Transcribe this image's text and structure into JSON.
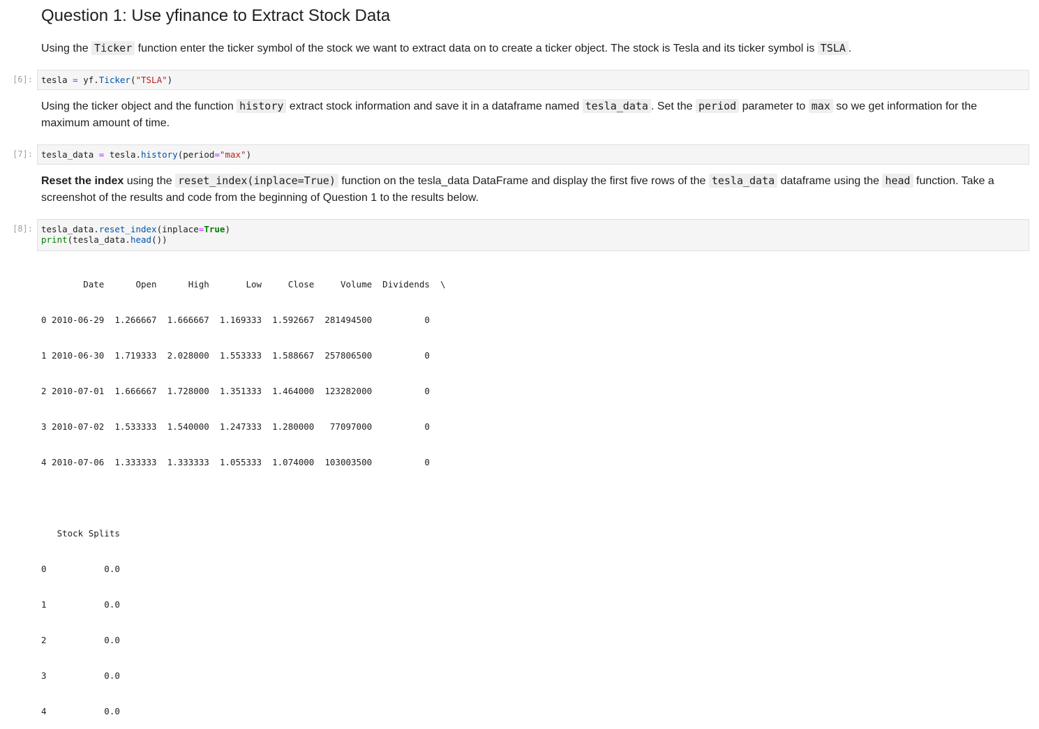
{
  "heading": "Question 1: Use yfinance to Extract Stock Data",
  "p1": {
    "t1": "Using the ",
    "c1": "Ticker",
    "t2": " function enter the ticker symbol of the stock we want to extract data on to create a ticker object. The stock is Tesla and its ticker symbol is ",
    "c2": "TSLA",
    "t3": "."
  },
  "cell6": {
    "prompt": "[6]:",
    "a": "tesla ",
    "op": "=",
    "b": " yf.",
    "fn": "Ticker",
    "c": "(",
    "str": "\"TSLA\"",
    "d": ")"
  },
  "p2": {
    "t1": "Using the ticker object and the function ",
    "c1": "history",
    "t2": " extract stock information and save it in a dataframe named ",
    "c2": "tesla_data",
    "t3": ". Set the ",
    "c3": "period",
    "t4": " parameter to ",
    "c4": "max",
    "t5": " so we get information for the maximum amount of time."
  },
  "cell7": {
    "prompt": "[7]:",
    "a": "tesla_data ",
    "op": "=",
    "b": " tesla.",
    "fn": "history",
    "c": "(period",
    "op2": "=",
    "str": "\"max\"",
    "d": ")"
  },
  "p3": {
    "bold": "Reset the index",
    "t1": " using the ",
    "c1": "reset_index(inplace=True)",
    "t2": " function on the tesla_data DataFrame and display the first five rows of the ",
    "c2": "tesla_data",
    "t3": " dataframe using the ",
    "c3": "head",
    "t4": " function. Take a screenshot of the results and code from the beginning of Question 1 to the results below."
  },
  "cell8": {
    "prompt": "[8]:",
    "l1a": "tesla_data.",
    "l1fn": "reset_index",
    "l1b": "(inplace",
    "l1op": "=",
    "l1kw": "True",
    "l1c": ")",
    "l2fn": "print",
    "l2a": "(tesla_data.",
    "l2fn2": "head",
    "l2b": "())"
  },
  "output": {
    "lines": [
      "        Date      Open      High       Low     Close     Volume  Dividends  \\",
      "0 2010-06-29  1.266667  1.666667  1.169333  1.592667  281494500          0",
      "1 2010-06-30  1.719333  2.028000  1.553333  1.588667  257806500          0",
      "2 2010-07-01  1.666667  1.728000  1.351333  1.464000  123282000          0",
      "3 2010-07-02  1.533333  1.540000  1.247333  1.280000   77097000          0",
      "4 2010-07-06  1.333333  1.333333  1.055333  1.074000  103003500          0",
      "",
      "   Stock Splits",
      "0           0.0",
      "1           0.0",
      "2           0.0",
      "3           0.0",
      "4           0.0"
    ]
  }
}
